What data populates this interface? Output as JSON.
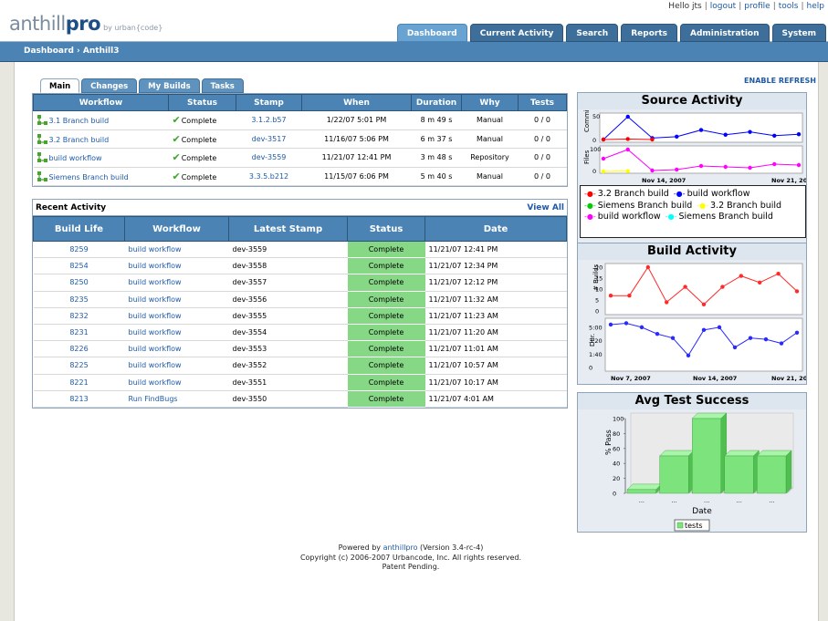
{
  "header": {
    "logo_main": "anthill",
    "logo_bold": "pro",
    "logo_by": "by urban{code}",
    "greeting": "Hello jts",
    "links": [
      "logout",
      "profile",
      "tools",
      "help"
    ],
    "tabs": [
      "Dashboard",
      "Current Activity",
      "Search",
      "Reports",
      "Administration",
      "System"
    ],
    "active_tab": "Dashboard"
  },
  "breadcrumb": {
    "root": "Dashboard",
    "separator": "›",
    "current": "Anthill3"
  },
  "enable_refresh": "ENABLE REFRESH",
  "subtabs": [
    "Main",
    "Changes",
    "My Builds",
    "Tasks"
  ],
  "workflows": {
    "columns": [
      "Workflow",
      "Status",
      "Stamp",
      "When",
      "Duration",
      "Why",
      "Tests"
    ],
    "rows": [
      {
        "workflow": "3.1 Branch build",
        "status": "Complete",
        "stamp": "3.1.2.b57",
        "when": "1/22/07 5:01 PM",
        "duration": "8 m 49 s",
        "why": "Manual",
        "tests": "0 / 0"
      },
      {
        "workflow": "3.2 Branch build",
        "status": "Complete",
        "stamp": "dev-3517",
        "when": "11/16/07 5:06 PM",
        "duration": "6 m 37 s",
        "why": "Manual",
        "tests": "0 / 0"
      },
      {
        "workflow": "build workflow",
        "status": "Complete",
        "stamp": "dev-3559",
        "when": "11/21/07 12:41 PM",
        "duration": "3 m 48 s",
        "why": "Repository",
        "tests": "0 / 0"
      },
      {
        "workflow": "Siemens Branch build",
        "status": "Complete",
        "stamp": "3.3.5.b212",
        "when": "11/15/07 6:06 PM",
        "duration": "5 m 40 s",
        "why": "Manual",
        "tests": "0 / 0"
      }
    ]
  },
  "recent_activity": {
    "title": "Recent Activity",
    "view_all": "View All",
    "columns": [
      "Build Life",
      "Workflow",
      "Latest Stamp",
      "Status",
      "Date"
    ],
    "rows": [
      {
        "build_life": "8259",
        "workflow": "build workflow",
        "stamp": "dev-3559",
        "status": "Complete",
        "date": "11/21/07 12:41 PM"
      },
      {
        "build_life": "8254",
        "workflow": "build workflow",
        "stamp": "dev-3558",
        "status": "Complete",
        "date": "11/21/07 12:34 PM"
      },
      {
        "build_life": "8250",
        "workflow": "build workflow",
        "stamp": "dev-3557",
        "status": "Complete",
        "date": "11/21/07 12:12 PM"
      },
      {
        "build_life": "8235",
        "workflow": "build workflow",
        "stamp": "dev-3556",
        "status": "Complete",
        "date": "11/21/07 11:32 AM"
      },
      {
        "build_life": "8232",
        "workflow": "build workflow",
        "stamp": "dev-3555",
        "status": "Complete",
        "date": "11/21/07 11:23 AM"
      },
      {
        "build_life": "8231",
        "workflow": "build workflow",
        "stamp": "dev-3554",
        "status": "Complete",
        "date": "11/21/07 11:20 AM"
      },
      {
        "build_life": "8226",
        "workflow": "build workflow",
        "stamp": "dev-3553",
        "status": "Complete",
        "date": "11/21/07 11:01 AM"
      },
      {
        "build_life": "8225",
        "workflow": "build workflow",
        "stamp": "dev-3552",
        "status": "Complete",
        "date": "11/21/07 10:57 AM"
      },
      {
        "build_life": "8221",
        "workflow": "build workflow",
        "stamp": "dev-3551",
        "status": "Complete",
        "date": "11/21/07 10:17 AM"
      },
      {
        "build_life": "8213",
        "workflow": "Run FindBugs",
        "stamp": "dev-3550",
        "status": "Complete",
        "date": "11/21/07 4:01 AM"
      }
    ]
  },
  "source_activity": {
    "title": "Source Activity",
    "legend": [
      {
        "label": "3.2 Branch build",
        "color": "#ff0000"
      },
      {
        "label": "build workflow",
        "color": "#0000ff"
      },
      {
        "label": "Siemens Branch build",
        "color": "#00cc00"
      },
      {
        "label": "3.2 Branch build",
        "color": "#ffff00"
      },
      {
        "label": "build workflow",
        "color": "#ff00ff"
      },
      {
        "label": "Siemens Branch build",
        "color": "#00ffff"
      }
    ]
  },
  "build_activity": {
    "title": "Build Activity"
  },
  "avg_test": {
    "title": "Avg Test Success",
    "legend": "tests",
    "color": "#7de37d"
  },
  "chart_data": [
    {
      "type": "line",
      "title": "Source Activity",
      "ylabel": "Commits",
      "x_ticks": [
        "Nov 14, 2007",
        "Nov 21, 20"
      ],
      "ylim": [
        0,
        50
      ],
      "y_ticks": [
        "0",
        "50"
      ],
      "series": [
        {
          "name": "3.2 Branch build",
          "x": [
            0,
            1,
            2
          ],
          "values": [
            2,
            3,
            2
          ]
        },
        {
          "name": "build workflow",
          "x": [
            0,
            1,
            2,
            3,
            4,
            5,
            6,
            7,
            8
          ],
          "values": [
            2,
            50,
            5,
            8,
            22,
            12,
            18,
            10,
            13
          ]
        }
      ]
    },
    {
      "type": "line",
      "ylabel": "Files",
      "x_ticks": [
        "Nov 14, 2007",
        "Nov 21, 20"
      ],
      "ylim": [
        0,
        100
      ],
      "y_ticks": [
        "0",
        "100"
      ],
      "series": [
        {
          "name": "3.2 Branch build",
          "x": [
            0,
            1
          ],
          "values": [
            0,
            2
          ]
        },
        {
          "name": "build workflow",
          "x": [
            0,
            1,
            2,
            3,
            4,
            5,
            6,
            7,
            8
          ],
          "values": [
            70,
            120,
            5,
            10,
            30,
            25,
            20,
            40,
            35
          ]
        },
        {
          "name": "Siemens Branch build",
          "x": [
            0,
            1
          ],
          "values": [
            0,
            0
          ]
        }
      ]
    },
    {
      "type": "line",
      "title": "Build Activity",
      "ylabel": "# Builds",
      "ylim": [
        0,
        20
      ],
      "y_ticks": [
        "0",
        "5",
        "10",
        "15",
        "20"
      ],
      "x_ticks": [
        "Nov 7, 2007",
        "Nov 14, 2007",
        "Nov 21, 20"
      ],
      "values": [
        7,
        7,
        20,
        4,
        11,
        3,
        11,
        16,
        13,
        17,
        9
      ]
    },
    {
      "type": "line",
      "ylabel": "Dur.",
      "ylim": [
        "0",
        "5:00"
      ],
      "y_ticks": [
        "0",
        "1:40",
        "3:20",
        "5:00"
      ],
      "x_ticks": [
        "Nov 7, 2007",
        "Nov 14, 2007",
        "Nov 21, 20"
      ],
      "values_seconds": [
        320,
        330,
        300,
        250,
        220,
        90,
        280,
        300,
        150,
        220,
        210,
        180,
        260
      ]
    },
    {
      "type": "bar",
      "title": "Avg Test Success",
      "ylabel": "% Pass",
      "xlabel": "Date",
      "ylim": [
        0,
        100
      ],
      "y_ticks": [
        "0",
        "20",
        "40",
        "60",
        "80",
        "100"
      ],
      "categories": [
        "...",
        "...",
        "...",
        "...",
        "..."
      ],
      "series": [
        {
          "name": "tests",
          "values": [
            5,
            50,
            100,
            50,
            50
          ]
        }
      ]
    }
  ],
  "footer": {
    "line1_pre": "Powered by ",
    "line1_link": "anthillpro",
    "line1_post": " (Version 3.4-rc-4)",
    "line2": "Copyright (c) 2006-2007 Urbancode, Inc. All rights reserved.",
    "line3": "Patent Pending."
  }
}
